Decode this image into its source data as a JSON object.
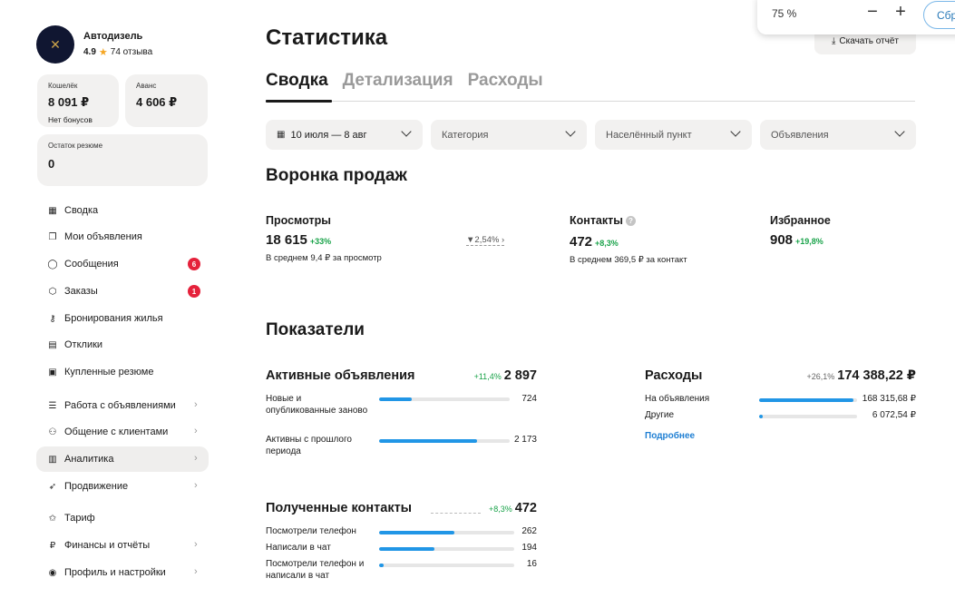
{
  "shop": {
    "name": "Автодизель",
    "rating": "4.9",
    "reviews": "74 отзыва"
  },
  "wallet": {
    "label": "Кошелёк",
    "value": "8 091 ₽",
    "sub": "Нет бонусов"
  },
  "advance": {
    "label": "Аванс",
    "value": "4 606 ₽"
  },
  "resume_balance": {
    "label": "Остаток резюме",
    "value": "0"
  },
  "nav": [
    {
      "label": "Сводка",
      "icon": "grid-icon"
    },
    {
      "label": "Мои объявления",
      "icon": "copy-icon"
    },
    {
      "label": "Сообщения",
      "icon": "chat-icon",
      "badge": "6"
    },
    {
      "label": "Заказы",
      "icon": "box-icon",
      "badge": "1"
    },
    {
      "label": "Бронирования жилья",
      "icon": "key-icon"
    },
    {
      "label": "Отклики",
      "icon": "document-icon"
    },
    {
      "label": "Купленные резюме",
      "icon": "resume-icon"
    },
    {
      "label": "Работа с объявлениями",
      "icon": "list-icon"
    },
    {
      "label": "Общение с клиентами",
      "icon": "users-icon"
    },
    {
      "label": "Аналитика",
      "icon": "bar-chart-icon"
    },
    {
      "label": "Продвижение",
      "icon": "rocket-icon"
    },
    {
      "label": "Тариф",
      "icon": "star-outline-icon"
    },
    {
      "label": "Финансы и отчёты",
      "icon": "ruble-icon"
    },
    {
      "label": "Профиль и настройки",
      "icon": "profile-icon"
    }
  ],
  "page_title": "Статистика",
  "download_label": "Скачать отчёт",
  "zoom": {
    "level": "75 %",
    "reset_label": "Сбросить"
  },
  "tabs": [
    "Сводка",
    "Детализация",
    "Расходы"
  ],
  "filters": {
    "dates": "10 июля — 8 авг",
    "category": "Категория",
    "city": "Населённый пункт",
    "ads": "Объявления"
  },
  "funnel": {
    "title": "Воронка продаж",
    "views": {
      "label": "Просмотры",
      "value": "18 615",
      "delta": "+33%",
      "sub": "В среднем 9,4 ₽ за просмотр"
    },
    "conversion": "2,54%",
    "contacts": {
      "label": "Контакты",
      "value": "472",
      "delta": "+8,3%",
      "sub": "В среднем 369,5 ₽ за контакт"
    },
    "favorites": {
      "label": "Избранное",
      "value": "908",
      "delta": "+19,8%"
    }
  },
  "indicators": {
    "title": "Показатели",
    "active_ads": {
      "title": "Активные объявления",
      "delta": "+11,4%",
      "total": "2 897",
      "rows": [
        {
          "label": "Новые и опубликованные заново",
          "value": "724",
          "fraction": 0.25
        },
        {
          "label": "Активны с прошлого периода",
          "value": "2 173",
          "fraction": 0.75
        }
      ]
    },
    "expenses": {
      "title": "Расходы",
      "delta": "+26,1%",
      "total": "174 388,22 ₽",
      "rows": [
        {
          "label": "На объявления",
          "value": "168 315,68 ₽",
          "fraction": 0.965
        },
        {
          "label": "Другие",
          "value": "6 072,54 ₽",
          "fraction": 0.035
        }
      ],
      "link": "Подробнее"
    },
    "contacts_received": {
      "title": "Полученные контакты",
      "delta": "+8,3%",
      "total": "472",
      "rows": [
        {
          "label": "Посмотрели телефон",
          "value": "262",
          "fraction": 0.555
        },
        {
          "label": "Написали в чат",
          "value": "194",
          "fraction": 0.411
        },
        {
          "label": "Посмотрели телефон и написали в чат",
          "value": "16",
          "fraction": 0.034
        }
      ]
    }
  }
}
